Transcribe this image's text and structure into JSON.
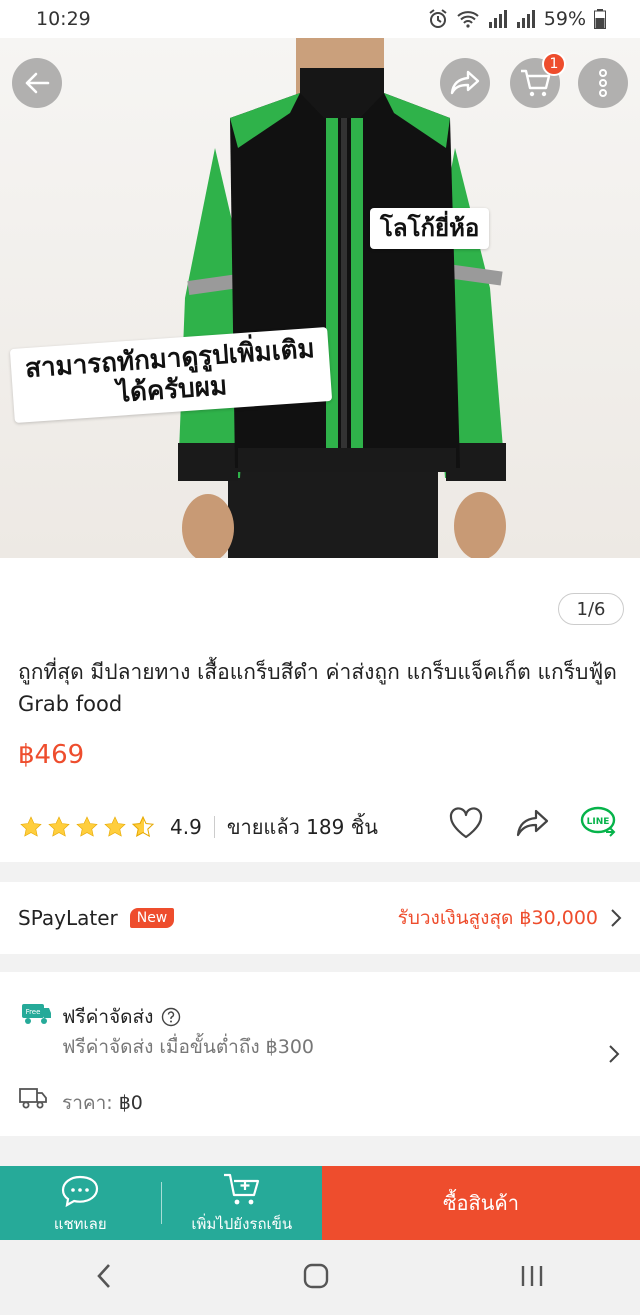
{
  "status": {
    "time": "10:29",
    "battery": "59%"
  },
  "hero": {
    "caption_logo": "โลโก้ยี่ห้อ",
    "caption_more": "สามารถทักมาดูรูปเพิ่มเติมได้ครับผม",
    "counter": "1/6",
    "cart_badge": "1"
  },
  "product": {
    "title": "ถูกที่สุด  มีปลายทาง เสื้อแกร็บสีดำ ค่าส่งถูก แกร็บแจ็คเก็ต แกร็บฟู้ด Grab food",
    "price": "฿469",
    "rating": "4.9",
    "rating_value": 4.5,
    "sold": "ขายแล้ว 189 ชิ้น"
  },
  "spay": {
    "label": "SPayLater",
    "tag": "New",
    "right_text": "รับวงเงินสูงสุด ฿30,000"
  },
  "shipping": {
    "free_badge": "Free",
    "title": "ฟรีค่าจัดส่ง",
    "subtitle": "ฟรีค่าจัดส่ง เมื่อขั้นต่ำถึง ฿300",
    "price_label": "ราคา:",
    "price_value": "฿0"
  },
  "bottom_bar": {
    "chat": "แชทเลย",
    "add_cart": "เพิ่มไปยังรถเข็น",
    "buy": "ซื้อสินค้า"
  },
  "colors": {
    "accent": "#ee4d2d",
    "teal": "#26aa99"
  }
}
